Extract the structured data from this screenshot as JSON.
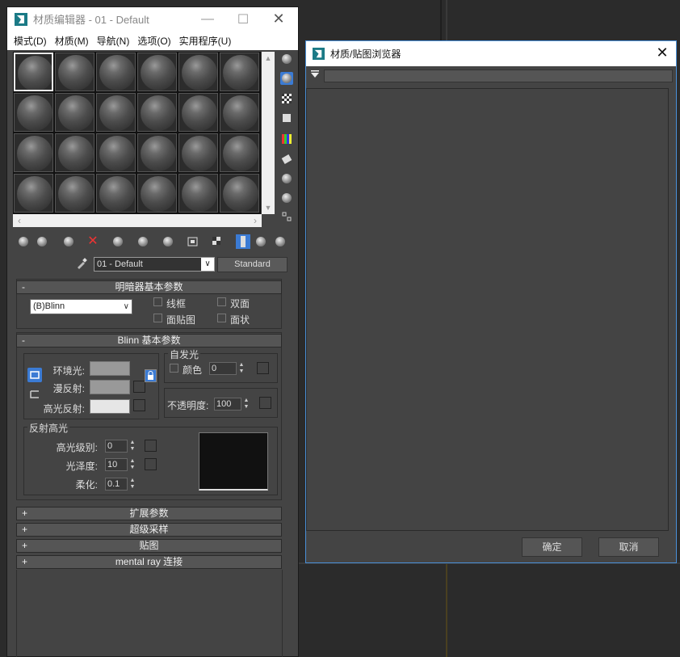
{
  "material_editor": {
    "title": "材质编辑器 - 01 - Default",
    "menu": [
      "模式(D)",
      "材质(M)",
      "导航(N)",
      "选项(O)",
      "实用程序(U)"
    ],
    "material_name": "01 - Default",
    "material_type": "Standard",
    "rollups": {
      "shader_basic": "明暗器基本参数",
      "blinn_basic": "Blinn 基本参数",
      "extended": "扩展参数",
      "supersampling": "超级采样",
      "maps": "贴图",
      "mental_ray": "mental ray 连接"
    },
    "shader": {
      "selected": "(B)Blinn",
      "options": [
        "线框",
        "双面",
        "面贴图",
        "面状"
      ]
    },
    "blinn": {
      "ambient_label": "环境光:",
      "diffuse_label": "漫反射:",
      "specular_label": "高光反射:",
      "self_illum_title": "自发光",
      "color_label": "颜色",
      "self_illum_value": "0",
      "opacity_label": "不透明度:",
      "opacity_value": "100"
    },
    "specular_highlights": {
      "title": "反射高光",
      "level_label": "高光级别:",
      "level_value": "0",
      "gloss_label": "光泽度:",
      "gloss_value": "10",
      "soften_label": "柔化:",
      "soften_value": "0.1"
    },
    "colors": {
      "ambient": "#999999",
      "diffuse": "#999999",
      "specular": "#e6e6e6",
      "selected_tool": "#3b7bd4"
    }
  },
  "browser": {
    "title": "材质/贴图浏览器",
    "search_value": "",
    "ok_label": "确定",
    "cancel_label": "取消"
  }
}
